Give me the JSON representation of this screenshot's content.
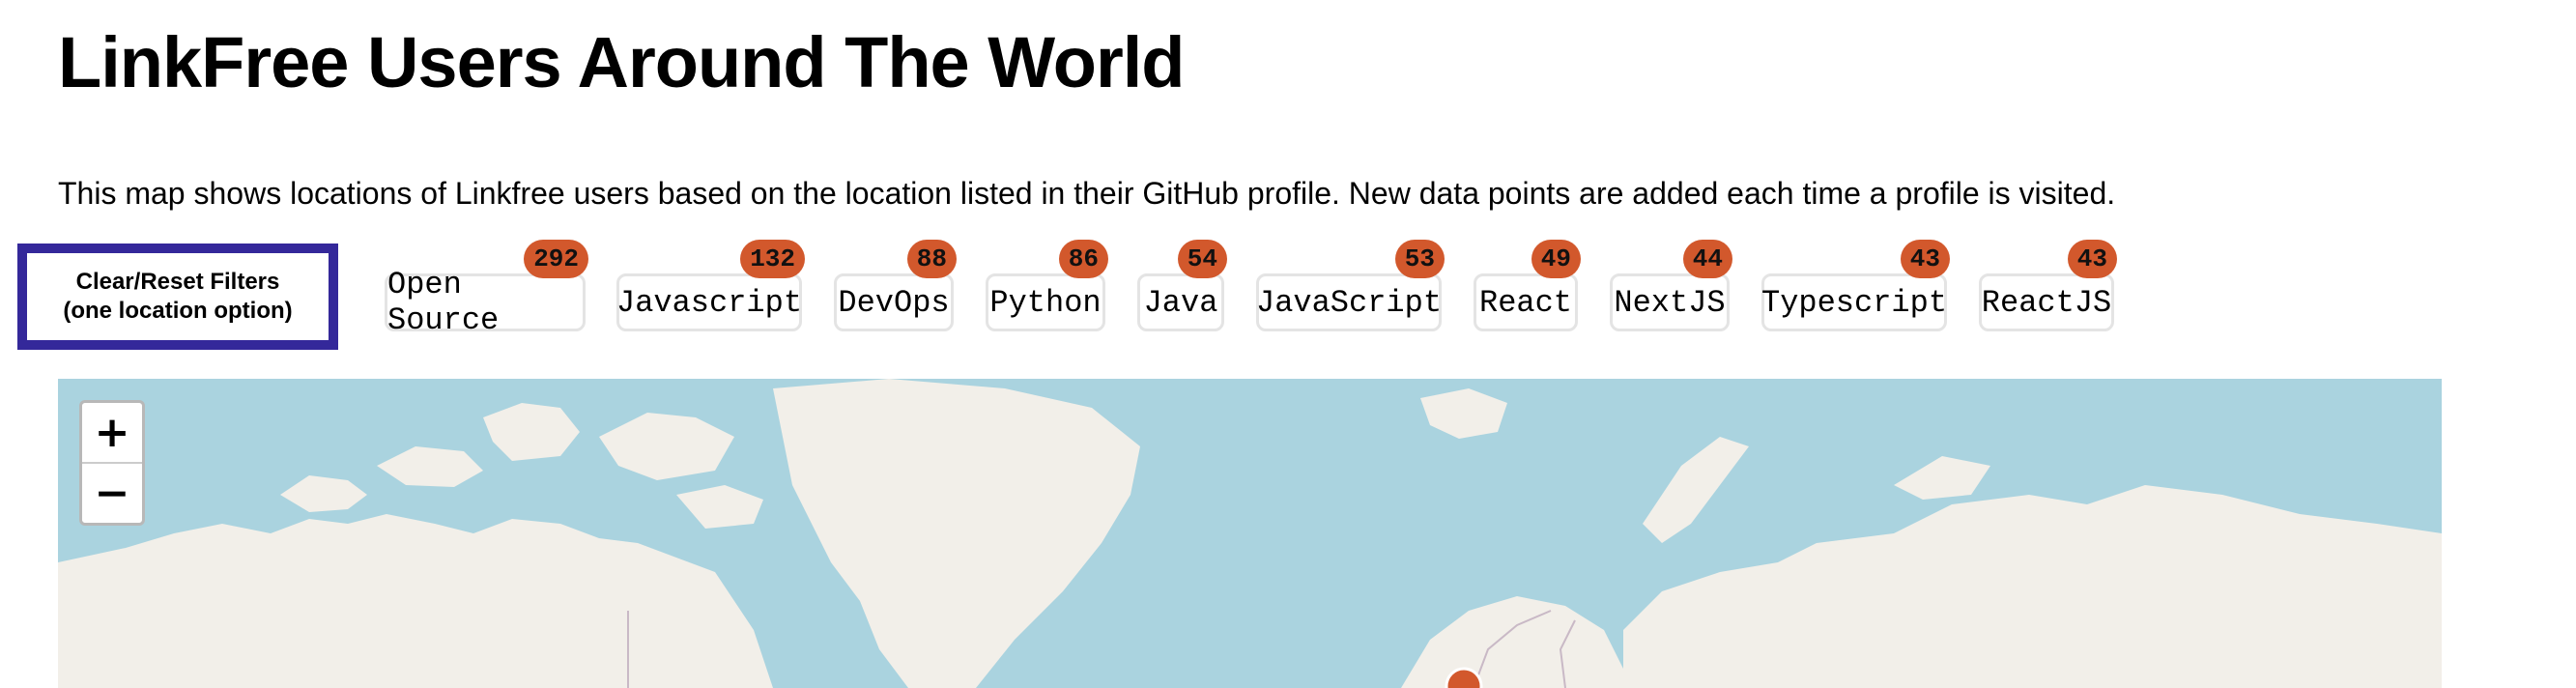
{
  "page": {
    "title": "LinkFree Users Around The World",
    "description": "This map shows locations of Linkfree users based on the location listed in their GitHub profile. New data points are added each time a profile is visited."
  },
  "filters": {
    "reset_line1": "Clear/Reset Filters",
    "reset_line2": "(one location option)",
    "tags": [
      {
        "label": "Open Source",
        "count": "292"
      },
      {
        "label": "Javascript",
        "count": "132"
      },
      {
        "label": "DevOps",
        "count": "88"
      },
      {
        "label": "Python",
        "count": "86"
      },
      {
        "label": "Java",
        "count": "54"
      },
      {
        "label": "JavaScript",
        "count": "53"
      },
      {
        "label": "React",
        "count": "49"
      },
      {
        "label": "NextJS",
        "count": "44"
      },
      {
        "label": "Typescript",
        "count": "43"
      },
      {
        "label": "ReactJS",
        "count": "43"
      }
    ]
  },
  "map": {
    "zoom_in_label": "+",
    "zoom_out_label": "−",
    "colors": {
      "water": "#aad3df",
      "land": "#f2efe9",
      "border": "#c9b9c6",
      "marker": "#d2582c"
    }
  }
}
